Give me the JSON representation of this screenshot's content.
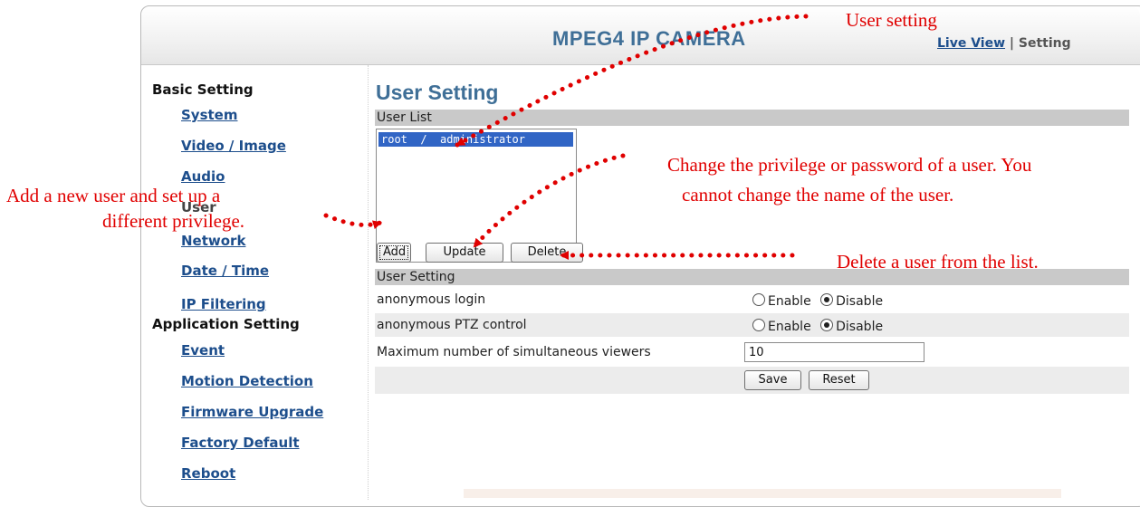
{
  "header": {
    "title": "MPEG4 IP CAMERA",
    "live_view": "Live View",
    "separator": "|",
    "setting": "Setting"
  },
  "sidebar": {
    "basic_heading": "Basic Setting",
    "basic_items": [
      "System",
      "Video / Image",
      "Audio",
      "User",
      "Network",
      "Date / Time",
      "IP Filtering"
    ],
    "application_heading": "Application Setting",
    "application_items": [
      "Event",
      "Motion Detection",
      "Firmware Upgrade",
      "Factory Default",
      "Reboot"
    ]
  },
  "main": {
    "title": "User Setting",
    "user_list_label": "User List",
    "users": [
      "root  /  administrator"
    ],
    "buttons": {
      "add": "Add",
      "update": "Update",
      "delete": "Delete"
    },
    "user_setting_label": "User Setting",
    "anonymous_login": {
      "label": "anonymous login",
      "enable": "Enable",
      "disable": "Disable",
      "selected": "Disable"
    },
    "anonymous_ptz": {
      "label": "anonymous PTZ control",
      "enable": "Enable",
      "disable": "Disable",
      "selected": "Disable"
    },
    "max_viewers": {
      "label": "Maximum number of simultaneous viewers",
      "value": "10"
    },
    "save": "Save",
    "reset": "Reset"
  },
  "annotations": {
    "user_setting": "User setting",
    "change_line1": "Change the privilege or password of a user. You",
    "change_line2": "cannot change the name of the user.",
    "add_line1": "Add a new user and set up a",
    "add_line2": "different privilege.",
    "delete": "Delete a user from the list."
  },
  "colors": {
    "annotation": "#e00000",
    "title_blue": "#3f6f97",
    "link_blue": "#1d4e8c",
    "selection": "#3165c5"
  }
}
